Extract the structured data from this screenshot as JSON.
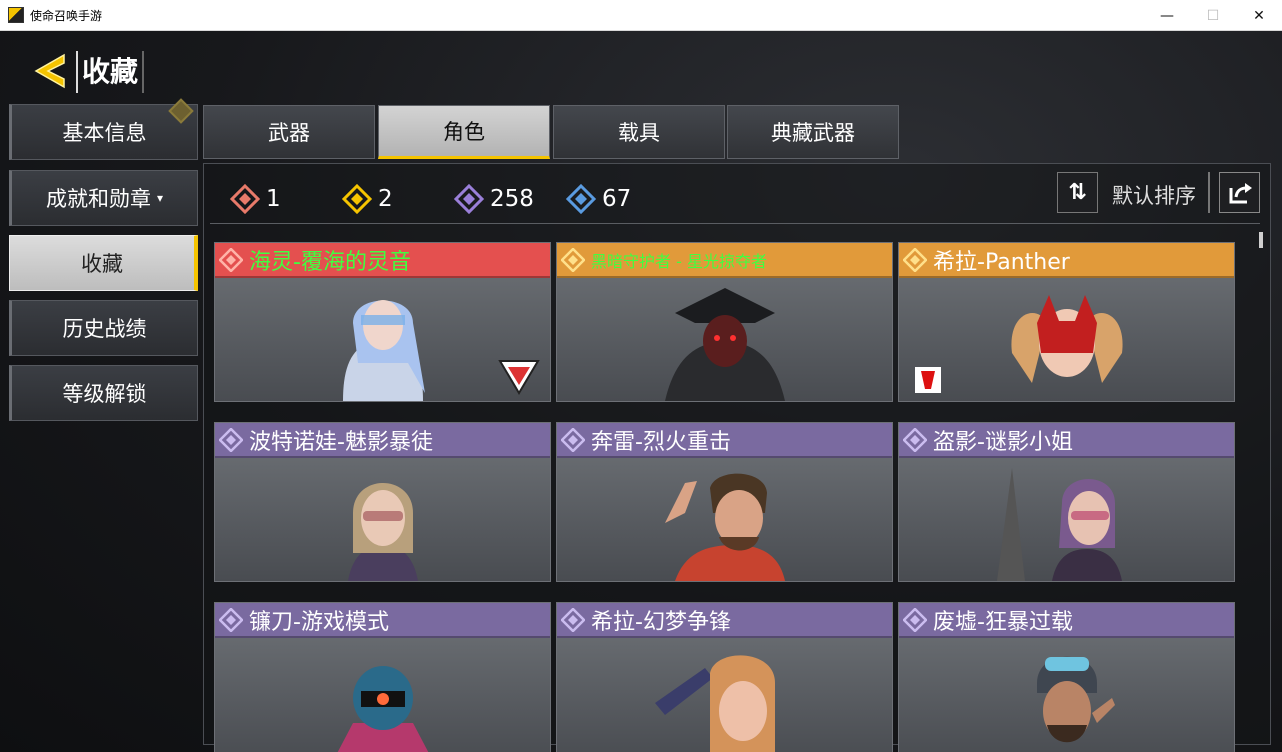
{
  "window": {
    "title": "使命召唤手游",
    "minimize": "—",
    "maximize": "☐",
    "close": "✕"
  },
  "header": {
    "title": "收藏",
    "back_icon": "back-arrow-icon"
  },
  "sidebar": {
    "items": [
      {
        "label": "基本信息",
        "active": false
      },
      {
        "label": "成就和勋章",
        "active": false,
        "caret": "▾"
      },
      {
        "label": "收藏",
        "active": true
      },
      {
        "label": "历史战绩",
        "active": false
      },
      {
        "label": "等级解锁",
        "active": false
      }
    ]
  },
  "tabs": [
    {
      "label": "武器",
      "active": false
    },
    {
      "label": "角色",
      "active": true
    },
    {
      "label": "载具",
      "active": false
    },
    {
      "label": "典藏武器",
      "active": false
    }
  ],
  "stats": [
    {
      "count": "1",
      "color": "#e87a6a"
    },
    {
      "count": "2",
      "color": "#f5c400"
    },
    {
      "count": "258",
      "color": "#9a7fd9"
    },
    {
      "count": "67",
      "color": "#5a9be0"
    }
  ],
  "sort": {
    "icon": "sort-icon",
    "label": "默认排序",
    "share_icon": "share-icon"
  },
  "colors": {
    "accent": "#f5c400",
    "legendary": "#e4504f",
    "epic_gold": "#e19a3a",
    "epic": "#7a6aa0"
  },
  "cards": [
    {
      "name": "海灵-覆海的灵音",
      "rarity": "red"
    },
    {
      "name": "黑暗守护者 - 星光掠夺者",
      "rarity": "orange"
    },
    {
      "name": "希拉-Panther",
      "rarity": "orange"
    },
    {
      "name": "波特诺娃-魅影暴徒",
      "rarity": "purple"
    },
    {
      "name": "奔雷-烈火重击",
      "rarity": "purple"
    },
    {
      "name": "盗影-谜影小姐",
      "rarity": "purple"
    },
    {
      "name": "镰刀-游戏模式",
      "rarity": "purple"
    },
    {
      "name": "希拉-幻梦争锋",
      "rarity": "purple"
    },
    {
      "name": "废墟-狂暴过载",
      "rarity": "purple"
    }
  ]
}
